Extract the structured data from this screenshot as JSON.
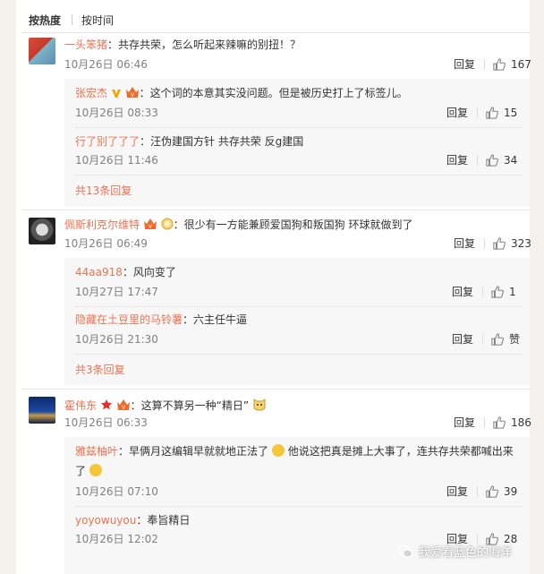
{
  "tabs": [
    "按热度",
    "按时间"
  ],
  "comments": [
    {
      "user": "一头笨猪",
      "text": "：共存共荣，怎么听起来辣嘛的别扭！？",
      "time": "10月26日 06:46",
      "reply_label": "回复",
      "likes": "167",
      "subs": [
        {
          "user": "张宏杰",
          "text": "：这个词的本意其实没问题。但是被历史打上了标签儿。",
          "time": "10月26日 08:33",
          "reply_label": "回复",
          "likes": "15"
        },
        {
          "user": "行了别了了了",
          "text": "：汪伪建国方针 共存共荣 反g建国",
          "time": "10月26日 11:46",
          "reply_label": "回复",
          "likes": "34"
        }
      ],
      "more": "共13条回复"
    },
    {
      "user": "佩斯利克尔维特",
      "text": "：很少有一方能兼顾爱国狗和叛国狗 环球就做到了",
      "time": "10月26日 06:49",
      "reply_label": "回复",
      "likes": "323",
      "subs": [
        {
          "user": "44aa918",
          "text": "：风向变了",
          "time": "10月27日 17:47",
          "reply_label": "回复",
          "likes": "1"
        },
        {
          "user": "隐藏在土豆里的马铃薯",
          "text": "：六主任牛逼",
          "time": "10月26日 21:30",
          "reply_label": "回复",
          "likes": "赞"
        }
      ],
      "more": "共3条回复"
    },
    {
      "user": "霍伟东",
      "text": "：这算不算另一种“精日”",
      "time": "10月26日 06:33",
      "reply_label": "回复",
      "likes": "186",
      "subs": [
        {
          "user": "雅兹柚叶",
          "text": "：早俩月这编辑早就就地正法了",
          "text_b": "他说这把真是摊上大事了，连共存共荣都喊出来",
          "text_c": "了",
          "time": "10月26日 07:10",
          "reply_label": "回复",
          "likes": "39"
        },
        {
          "user": "yoyowuyou",
          "text": "：奉旨精日",
          "time": "10月26日 12:02",
          "reply_label": "回复",
          "likes": "28"
        }
      ]
    }
  ],
  "watermark": "我爱看蓝色的海洋",
  "colors": {
    "username": "#eb7350",
    "subbox": "#f7f7f7",
    "text": "#333333",
    "time": "#808080"
  },
  "icons": [
    "thumb-up-icon",
    "verified-v-icon",
    "vip-crown-icon",
    "emoji-icon",
    "wechat-icon"
  ]
}
